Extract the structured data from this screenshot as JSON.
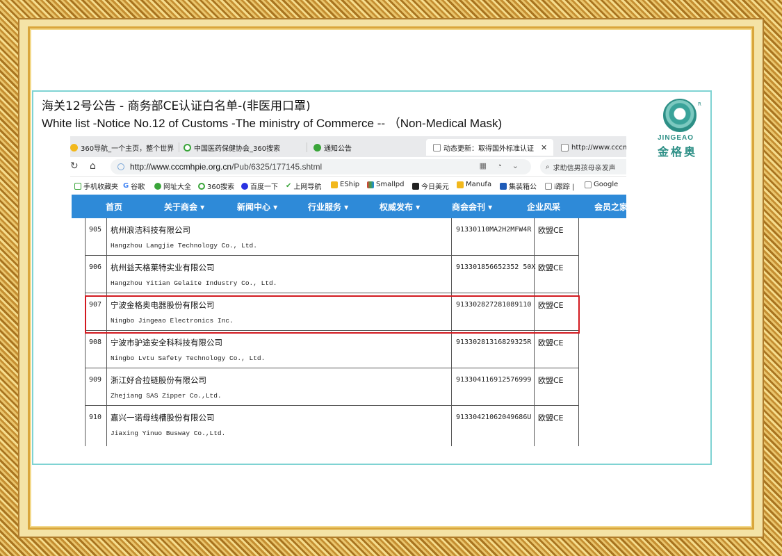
{
  "title": {
    "cn": "海关12号公告 - 商务部CE认证白名单-(非医用口罩)",
    "en": "White list -Notice No.12 of Customs -The ministry of Commerce   -- （Non-Medical Mask)"
  },
  "logo": {
    "en": "JINGEAO",
    "cn": "金格奥",
    "reg": "R"
  },
  "browser": {
    "tabs": [
      {
        "label": "360导航_一个主页，整个世界"
      },
      {
        "label": "中国医药保健协会_360搜索"
      },
      {
        "label": "通知公告"
      },
      {
        "label": "动态更新：取得国外标准认证"
      },
      {
        "label": "http://www.cccmh"
      }
    ],
    "url": {
      "host": "http://www.cccmhpie.org.cn",
      "path": "/Pub/6325/177145.shtml"
    },
    "search_placeholder": "求助信男孩母亲发声",
    "bookmarks": [
      {
        "label": "手机收藏夹"
      },
      {
        "label": "谷歌"
      },
      {
        "label": "网址大全"
      },
      {
        "label": "360搜索"
      },
      {
        "label": "百度一下"
      },
      {
        "label": "上网导航"
      },
      {
        "label": "EShip"
      },
      {
        "label": "Smallpd"
      },
      {
        "label": "今日美元"
      },
      {
        "label": "Manufa"
      },
      {
        "label": "集装箱公"
      },
      {
        "label": "i跟踪 |"
      },
      {
        "label": "Google"
      }
    ],
    "site_nav": [
      {
        "label": "首页"
      },
      {
        "label": "关于商会 ▾"
      },
      {
        "label": "新闻中心 ▾"
      },
      {
        "label": "行业服务 ▾"
      },
      {
        "label": "权威发布 ▾"
      },
      {
        "label": "商会会刊 ▾"
      },
      {
        "label": "企业风采"
      },
      {
        "label": "会员之家"
      }
    ]
  },
  "table": {
    "rows": [
      {
        "num": "905",
        "cn": "杭州浪洁科技有限公司",
        "en": "Hangzhou Langjie Technology Co., Ltd.",
        "code": "91330110MA2H2MFW4R",
        "cert": "欧盟CE"
      },
      {
        "num": "906",
        "cn": "杭州益天格莱特实业有限公司",
        "en": "Hangzhou Yitian Gelaite Industry Co., Ltd.",
        "code": "913301856652352 50X",
        "cert": "欧盟CE"
      },
      {
        "num": "907",
        "cn": "宁波金格奥电器股份有限公司",
        "en": "Ningbo Jingeao Electronics Inc.",
        "code": "913302827281089110",
        "cert": "欧盟CE"
      },
      {
        "num": "908",
        "cn": "宁波市驴途安全科科技有限公司",
        "en": "Ningbo Lvtu Safety Technology Co., Ltd.",
        "code": "91330281316829325R",
        "cert": "欧盟CE"
      },
      {
        "num": "909",
        "cn": "浙江好合拉链股份有限公司",
        "en": "Zhejiang SAS Zipper Co.,Ltd.",
        "code": "913304116912576999",
        "cert": "欧盟CE"
      },
      {
        "num": "910",
        "cn": "嘉兴一诺母线槽股份有限公司",
        "en": "Jiaxing Yinuo Busway Co.,Ltd.",
        "code": "91330421062049686U",
        "cert": "欧盟CE"
      }
    ]
  }
}
